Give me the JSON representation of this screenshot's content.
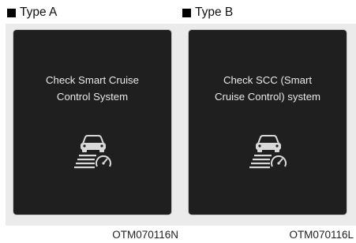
{
  "panels": [
    {
      "type_label": "Type A",
      "message_lines": [
        "Check Smart Cruise",
        "Control System"
      ],
      "icon": "smart-cruise-control-warning-icon",
      "code": "OTM070116N"
    },
    {
      "type_label": "Type B",
      "message_lines": [
        "Check SCC (Smart",
        "Cruise Control) system"
      ],
      "icon": "smart-cruise-control-warning-icon",
      "code": "OTM070116L"
    }
  ],
  "colors": {
    "screen_background": "#1f1f1f",
    "frame_background": "#ebebeb",
    "message_text": "#e9e9e9",
    "icon": "#d9d9d9"
  }
}
